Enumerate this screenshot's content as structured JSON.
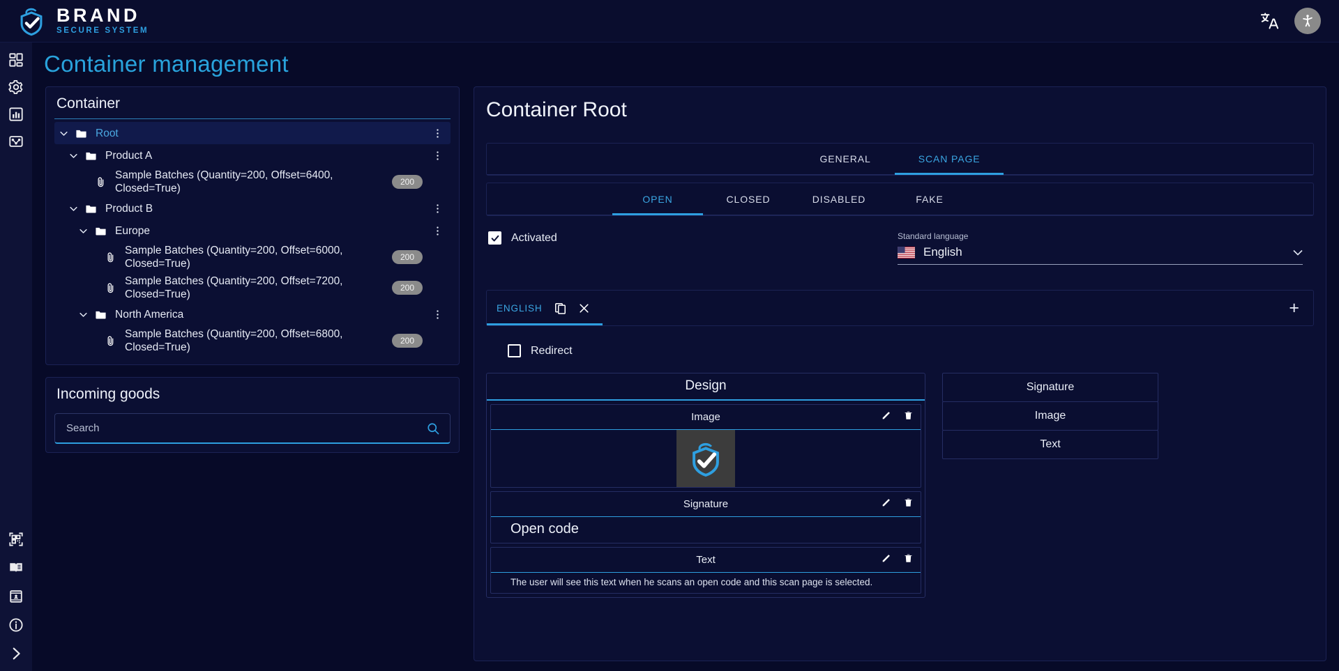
{
  "brand": {
    "name": "BRAND",
    "subtitle": "SECURE SYSTEM"
  },
  "topbar": {
    "translate_icon": "translate-icon",
    "accessibility_icon": "accessibility-icon"
  },
  "rail": {
    "top_items": [
      {
        "icon": "dashboard-icon",
        "name": "dashboard"
      },
      {
        "icon": "gear-icon",
        "name": "settings"
      },
      {
        "icon": "chart-icon",
        "name": "statistics"
      },
      {
        "icon": "distribution-icon",
        "name": "distribution"
      }
    ],
    "bottom_items": [
      {
        "icon": "qrcode-icon",
        "name": "codes"
      },
      {
        "icon": "book-icon",
        "name": "documentation"
      },
      {
        "icon": "contact-card-icon",
        "name": "contacts"
      },
      {
        "icon": "info-icon",
        "name": "about"
      },
      {
        "icon": "chevron-right-icon",
        "name": "expand-sidebar"
      }
    ]
  },
  "page": {
    "title": "Container management"
  },
  "container_panel": {
    "heading": "Container",
    "nodes": [
      {
        "type": "folder",
        "label": "Root",
        "indent": 0,
        "selected": true,
        "expanded": true,
        "menu": true
      },
      {
        "type": "folder",
        "label": "Product A",
        "indent": 1,
        "selected": false,
        "expanded": true,
        "menu": true
      },
      {
        "type": "file",
        "label": "Sample Batches (Quantity=200, Offset=6400, Closed=True)",
        "indent": 2,
        "badge": "200"
      },
      {
        "type": "folder",
        "label": "Product B",
        "indent": 1,
        "selected": false,
        "expanded": true,
        "menu": true
      },
      {
        "type": "folder",
        "label": "Europe",
        "indent": 2,
        "selected": false,
        "expanded": true,
        "menu": true
      },
      {
        "type": "file",
        "label": "Sample Batches (Quantity=200, Offset=6000, Closed=True)",
        "indent": 3,
        "badge": "200"
      },
      {
        "type": "file",
        "label": "Sample Batches (Quantity=200, Offset=7200, Closed=True)",
        "indent": 3,
        "badge": "200"
      },
      {
        "type": "folder",
        "label": "North America",
        "indent": 2,
        "selected": false,
        "expanded": true,
        "menu": true
      },
      {
        "type": "file",
        "label": "Sample Batches (Quantity=200, Offset=6800, Closed=True)",
        "indent": 3,
        "badge": "200"
      }
    ]
  },
  "incoming_goods": {
    "heading": "Incoming goods",
    "search_value": "",
    "search_placeholder": "Search",
    "search_icon": "search-icon"
  },
  "detail": {
    "title": "Container Root",
    "tabs": [
      {
        "label": "GENERAL",
        "active": false
      },
      {
        "label": "SCAN PAGE",
        "active": true
      }
    ],
    "subtabs": [
      {
        "label": "OPEN",
        "active": true
      },
      {
        "label": "CLOSED",
        "active": false
      },
      {
        "label": "DISABLED",
        "active": false
      },
      {
        "label": "FAKE",
        "active": false
      }
    ],
    "activated": {
      "label": "Activated",
      "checked": true
    },
    "standard_language": {
      "caption": "Standard language",
      "value": "English",
      "flag": "us-flag-icon"
    },
    "language_tabs": [
      {
        "label": "ENGLISH",
        "active": true,
        "copy_icon": "copy-icon",
        "close_icon": "close-icon"
      }
    ],
    "add_language_label": "+",
    "redirect": {
      "label": "Redirect",
      "checked": false
    },
    "design": {
      "title": "Design",
      "blocks": [
        {
          "kind": "image",
          "title": "Image",
          "value": "",
          "edit_icon": "pencil-icon",
          "delete_icon": "trash-icon"
        },
        {
          "kind": "signature",
          "title": "Signature",
          "value": "Open code",
          "edit_icon": "pencil-icon",
          "delete_icon": "trash-icon"
        },
        {
          "kind": "text",
          "title": "Text",
          "value": "The user will see this text when he scans an open code and this scan page is selected.",
          "edit_icon": "pencil-icon",
          "delete_icon": "trash-icon"
        }
      ]
    },
    "palette": [
      {
        "label": "Signature"
      },
      {
        "label": "Image"
      },
      {
        "label": "Text"
      }
    ]
  },
  "colors": {
    "accent": "#2e9fe0",
    "page_bg": "#070a28",
    "panel_bg": "#0b0f33",
    "title": "#29a3dc",
    "badge": "#8b8b8b"
  }
}
